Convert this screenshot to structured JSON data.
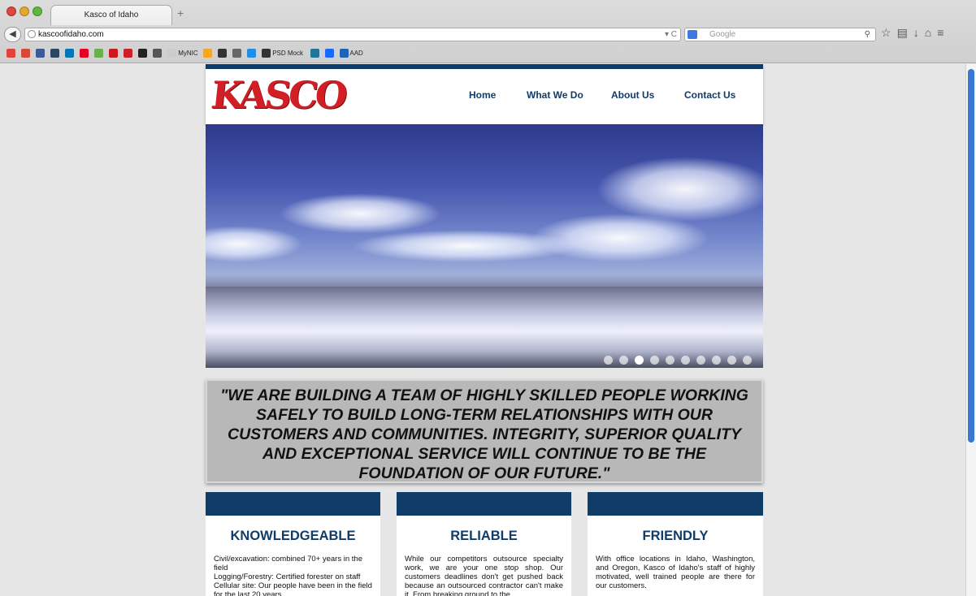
{
  "browser": {
    "tab_title": "Kasco of Idaho",
    "new_tab_symbol": "+",
    "url": "kascoofidaho.com",
    "search_placeholder": "Google",
    "bookmarks": [
      {
        "label": "",
        "color": "#e0433a"
      },
      {
        "label": "",
        "color": "#d64937"
      },
      {
        "label": "",
        "color": "#3b5998"
      },
      {
        "label": "",
        "color": "#2c4762"
      },
      {
        "label": "",
        "color": "#0077b5"
      },
      {
        "label": "",
        "color": "#e60023"
      },
      {
        "label": "",
        "color": "#6ab04c"
      },
      {
        "label": "",
        "color": "#cc181e"
      },
      {
        "label": "",
        "color": "#cb2027"
      },
      {
        "label": "",
        "color": "#222222"
      },
      {
        "label": "",
        "color": "#555555"
      },
      {
        "label": "MyNIC",
        "color": "#cccccc"
      },
      {
        "label": "",
        "color": "#f5a623"
      },
      {
        "label": "",
        "color": "#333333"
      },
      {
        "label": "",
        "color": "#666666"
      },
      {
        "label": "",
        "color": "#1f8fe5"
      },
      {
        "label": "PSD Mock",
        "color": "#333333"
      },
      {
        "label": "",
        "color": "#21759b"
      },
      {
        "label": "",
        "color": "#1769ff"
      },
      {
        "label": "AAD",
        "color": "#1e63b8"
      }
    ]
  },
  "site": {
    "logo": "KASCO",
    "nav": [
      "Home",
      "What We Do",
      "About Us",
      "Contact Us"
    ],
    "slider": {
      "count": 10,
      "active_index": 2
    },
    "quote": "\"WE ARE BUILDING A TEAM OF HIGHLY SKILLED PEOPLE WORKING SAFELY TO BUILD LONG-TERM RELATIONSHIPS WITH OUR CUSTOMERS AND COMMUNITIES. INTEGRITY, SUPERIOR QUALITY AND EXCEPTIONAL SERVICE WILL CONTINUE TO BE THE FOUNDATION OF OUR FUTURE.\"",
    "cards": [
      {
        "title": "KNOWLEDGEABLE",
        "lines": [
          "Civil/excavation: combined 70+ years in the field",
          "Logging/Forestry: Certified forester on staff",
          "Cellular site: Our people have been in the field for the last 20 years"
        ]
      },
      {
        "title": "RELIABLE",
        "text": "While our competitors outsource specialty work, we are your one stop shop. Our customers deadlines don't get pushed back because an outsourced contractor can't make it. From breaking ground to the"
      },
      {
        "title": "FRIENDLY",
        "text": "With office locations in Idaho, Washington, and Oregon, Kasco of Idaho's staff of highly motivated, well trained people are there for our customers."
      }
    ]
  },
  "colors": {
    "brand_navy": "#0f3c68",
    "logo_red": "#d21f26"
  }
}
